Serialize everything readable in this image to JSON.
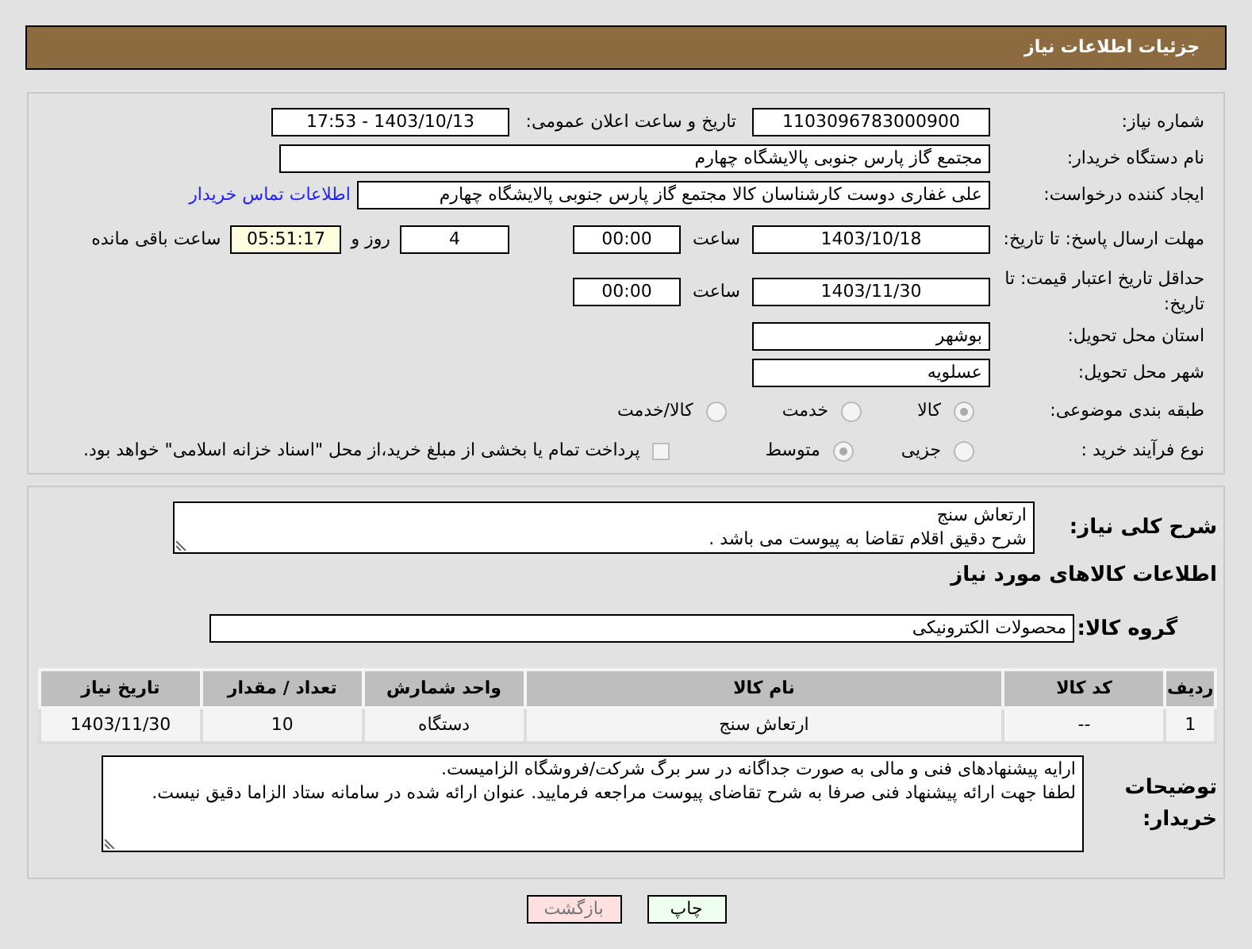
{
  "header": {
    "title": "جزئیات اطلاعات نیاز"
  },
  "need_number": {
    "label": "شماره نیاز:",
    "value": "1103096783000900"
  },
  "announce": {
    "label": "تاریخ و ساعت اعلان عمومی:",
    "value": "1403/10/13 - 17:53"
  },
  "buyer_org": {
    "label": "نام دستگاه خریدار:",
    "value": "مجتمع گاز پارس جنوبی  پالایشگاه چهارم"
  },
  "requester": {
    "label": "ایجاد کننده درخواست:",
    "value": "علی غفاری دوست کارشناسان کالا مجتمع گاز پارس جنوبی  پالایشگاه چهارم",
    "link": "اطلاعات تماس خریدار"
  },
  "deadline": {
    "label": "مهلت ارسال پاسخ: تا تاریخ:",
    "date": "1403/10/18",
    "time_label": "ساعت",
    "time": "00:00",
    "days": "4",
    "days_label": "روز و",
    "remaining": "05:51:17",
    "remaining_label": "ساعت باقی مانده"
  },
  "validity": {
    "label": "حداقل تاریخ اعتبار قیمت: تا تاریخ:",
    "date": "1403/11/30",
    "time_label": "ساعت",
    "time": "00:00"
  },
  "province": {
    "label": "استان محل تحویل:",
    "value": "بوشهر"
  },
  "city": {
    "label": "شهر محل تحویل:",
    "value": "عسلویه"
  },
  "category": {
    "label": "طبقه بندی موضوعی:",
    "options": [
      {
        "label": "کالا",
        "selected": true
      },
      {
        "label": "خدمت",
        "selected": false
      },
      {
        "label": "کالا/خدمت",
        "selected": false
      }
    ]
  },
  "purchase_type": {
    "label": "نوع فرآیند خرید :",
    "options": [
      {
        "label": "جزیی",
        "selected": false
      },
      {
        "label": "متوسط",
        "selected": true
      }
    ],
    "payment": {
      "label": "پرداخت تمام یا بخشی از مبلغ خرید،از محل \"اسناد خزانه اسلامی\" خواهد بود.",
      "checked": false
    }
  },
  "description": {
    "label": "شرح کلی نیاز:",
    "lines": [
      "ارتعاش سنج",
      "شرح دقیق اقلام تقاضا به پیوست می باشد ."
    ]
  },
  "goods_title": "اطلاعات کالاهای مورد نیاز",
  "goods_group": {
    "label": "گروه کالا:",
    "value": "محصولات الکترونیکی"
  },
  "table": {
    "columns": [
      "ردیف",
      "کد کالا",
      "نام کالا",
      "واحد شمارش",
      "تعداد / مقدار",
      "تاریخ نیاز"
    ],
    "rows": [
      [
        "1",
        "--",
        "ارتعاش سنج",
        "دستگاه",
        "10",
        "1403/11/30"
      ]
    ]
  },
  "buyer_notes": {
    "label": "توضیحات خریدار:",
    "lines": [
      "ارایه پیشنهادهای فنی و مالی به صورت جداگانه در سر برگ شرکت/فروشگاه الزامیست.",
      "لطفا جهت ارائه پیشنهاد فنی صرفا به شرح تقاضای پیوست مراجعه فرمایید. عنوان ارائه شده در سامانه ستاد الزاما دقیق نیست."
    ]
  },
  "buttons": [
    {
      "label": "چاپ",
      "kind": "print"
    },
    {
      "label": "بازگشت",
      "kind": "back"
    }
  ]
}
